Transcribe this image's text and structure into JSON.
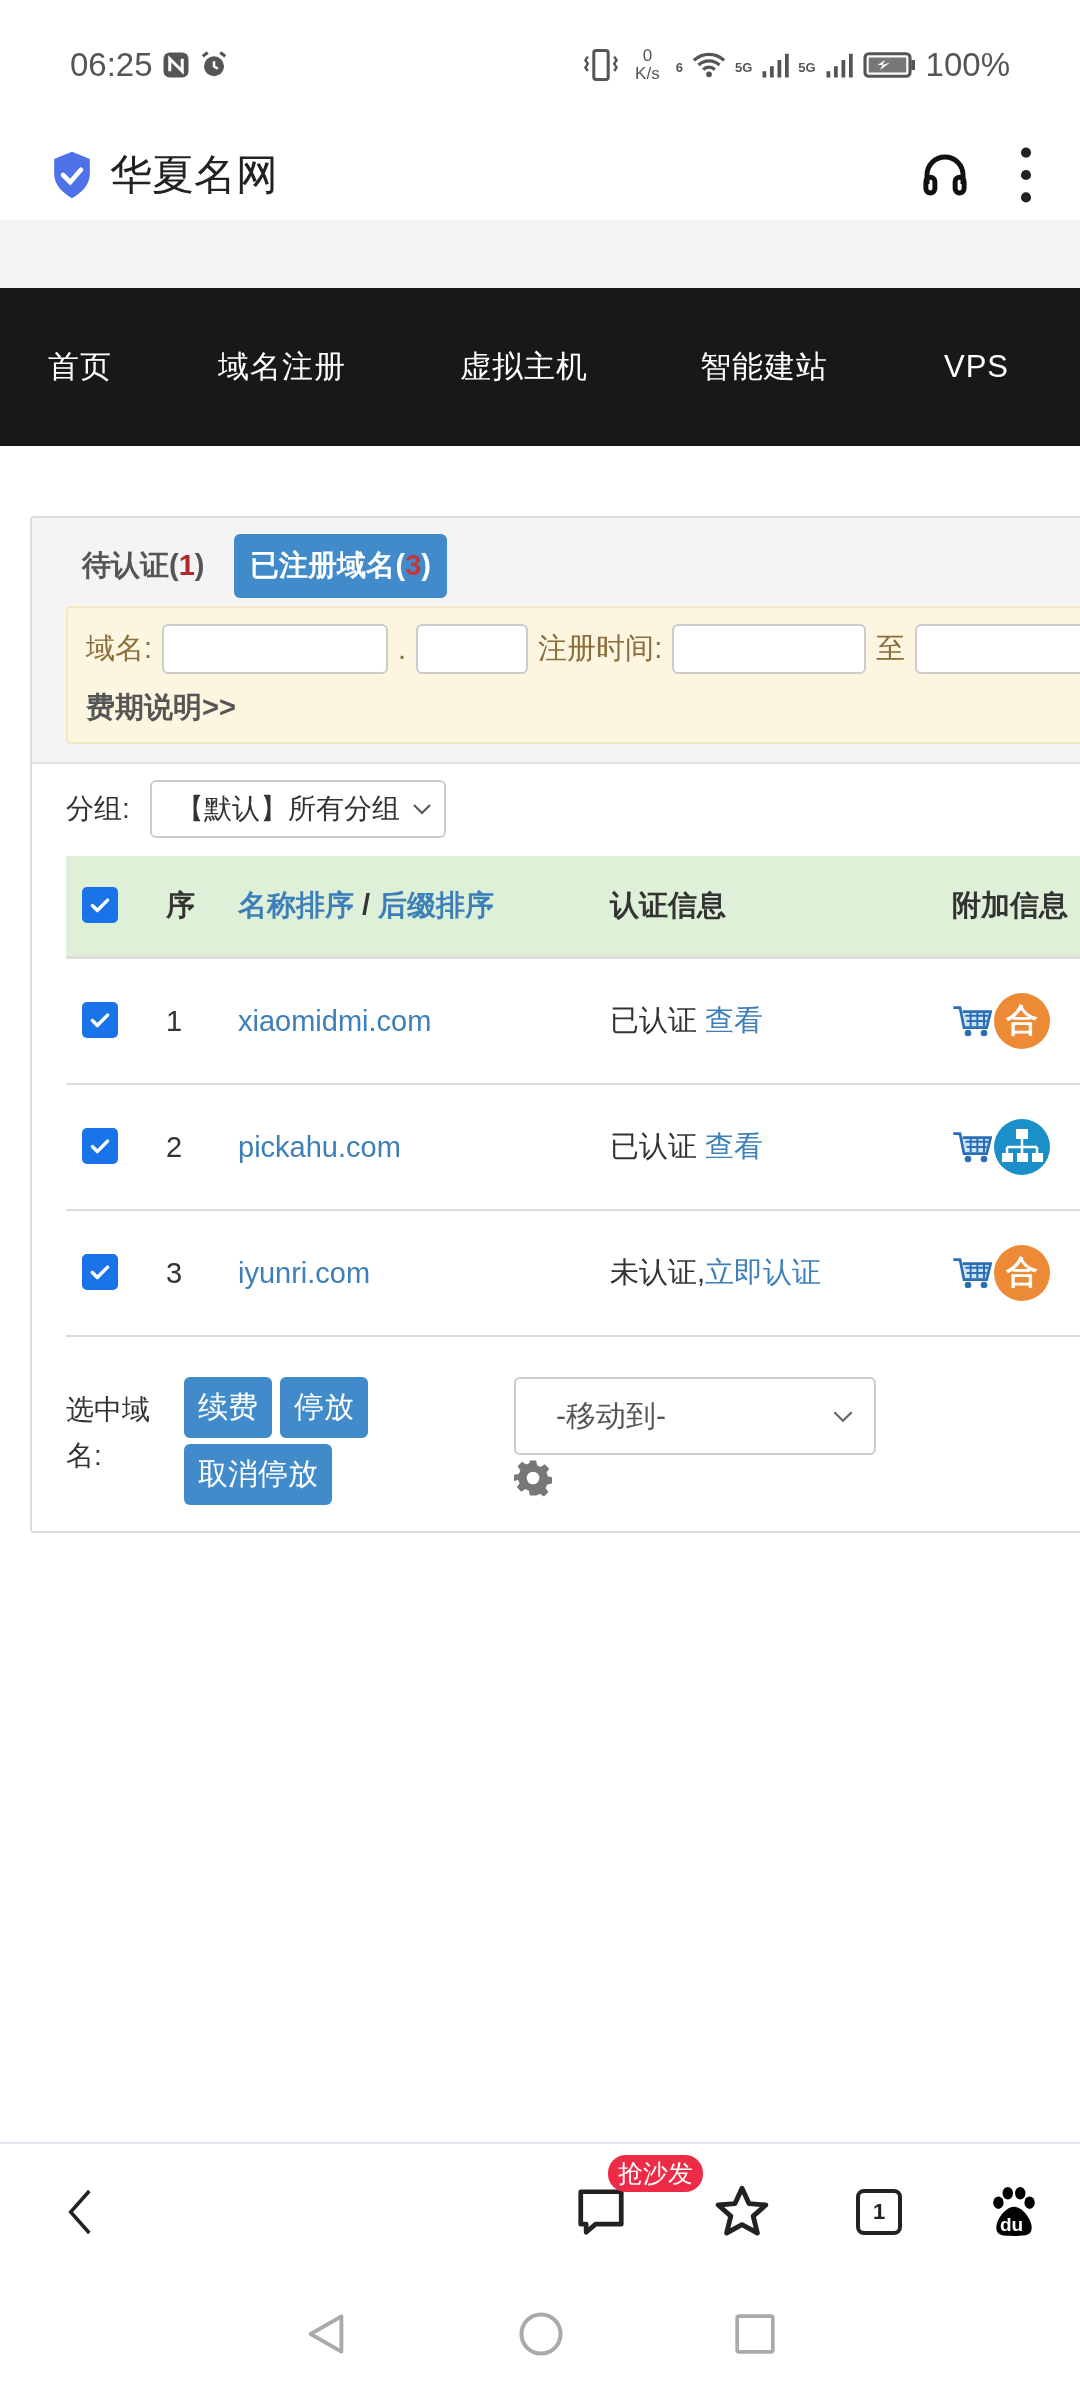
{
  "status_bar": {
    "time": "06:25",
    "net_speed_value": "0",
    "net_speed_unit": "K/s",
    "wifi_label": "6",
    "sim1_label": "5G",
    "sim2_label": "5G",
    "battery": "100%"
  },
  "browser": {
    "title": "华夏名网"
  },
  "nav": [
    {
      "label": "首页"
    },
    {
      "label": "域名注册"
    },
    {
      "label": "虚拟主机"
    },
    {
      "label": "智能建站"
    },
    {
      "label": "VPS"
    }
  ],
  "tabs": [
    {
      "prefix": "待认证(",
      "count": "1",
      "suffix": ")",
      "selected": false
    },
    {
      "prefix": "已注册域名(",
      "count": "3",
      "suffix": ")",
      "selected": true
    }
  ],
  "filter": {
    "domain_label": "域名:",
    "dot": ".",
    "date_label": "注册时间:",
    "to_label": "至",
    "fee_link": "费期说明>>"
  },
  "group": {
    "label": "分组:",
    "value": "【默认】所有分组"
  },
  "table": {
    "header": {
      "checked": true,
      "seq": "序",
      "sort_name": "名称排序",
      "sort_sep": "/",
      "sort_suffix": "后缀排序",
      "auth": "认证信息",
      "extra": "附加信息"
    },
    "rows": [
      {
        "checked": true,
        "seq": "1",
        "domain": "xiaomidmi.com",
        "auth_status": "已认证",
        "auth_link": "查看",
        "badge": {
          "kind": "text",
          "text": "合",
          "color": "#ec8a35"
        }
      },
      {
        "checked": true,
        "seq": "2",
        "domain": "pickahu.com",
        "auth_status": "已认证",
        "auth_link": "查看",
        "badge": {
          "kind": "sitemap",
          "color": "#1b8fc8"
        }
      },
      {
        "checked": true,
        "seq": "3",
        "domain": "iyunri.com",
        "auth_status": "未认证,",
        "auth_link": "立即认证",
        "badge": {
          "kind": "text",
          "text": "合",
          "color": "#ec8a35"
        }
      }
    ]
  },
  "actions": {
    "label": "选中域名:",
    "buttons": [
      {
        "label": "续费"
      },
      {
        "label": "停放"
      },
      {
        "label": "取消停放"
      }
    ],
    "move_to": "-移动到-"
  },
  "toolbar": {
    "comment_badge": "抢沙发",
    "tab_count": "1",
    "logo_text": "du"
  }
}
